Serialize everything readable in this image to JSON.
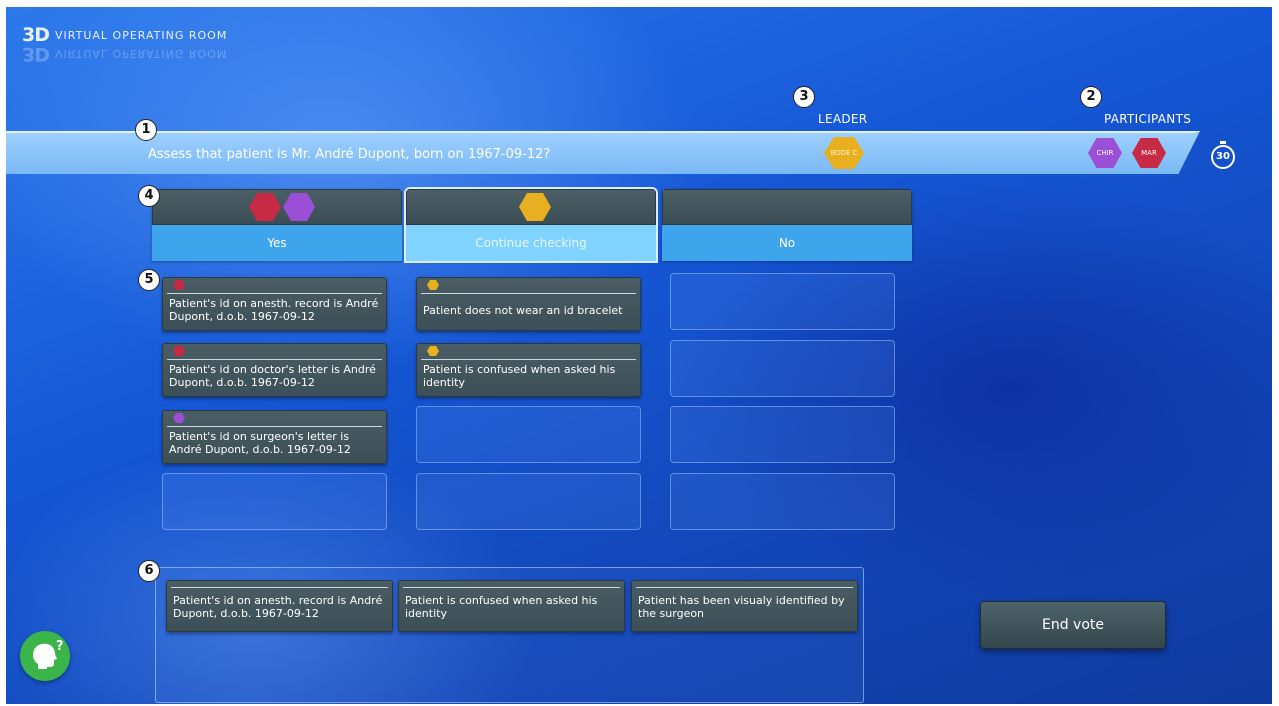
{
  "app": {
    "logo_3d": "3D",
    "logo_text": "VIRTUAL OPERATING ROOM"
  },
  "header": {
    "leader_label": "LEADER",
    "participants_label": "PARTICIPANTS",
    "question": "Assess that patient is Mr. André Dupont, born on 1967-09-12?",
    "leader_badge": "BODE C",
    "participants": [
      "CHIR",
      "MAR"
    ],
    "timer": "30"
  },
  "callouts": [
    "1",
    "2",
    "3",
    "4",
    "5",
    "6"
  ],
  "columns": [
    {
      "label": "Yes"
    },
    {
      "label": "Continue checking"
    },
    {
      "label": "No"
    }
  ],
  "cards": {
    "yes": [
      "Patient's id on anesth. record is André Dupont, d.o.b. 1967-09-12",
      "Patient's id on doctor's letter is André Dupont, d.o.b. 1967-09-12",
      "Patient's id on surgeon's letter is André Dupont, d.o.b. 1967-09-12"
    ],
    "continue": [
      "Patient does not wear an id bracelet",
      "Patient is confused when asked his identity"
    ]
  },
  "tray": [
    "Patient's id on anesth. record is André Dupont, d.o.b. 1967-09-12",
    "Patient is confused when asked his identity",
    "Patient has been visualy identified by the surgeon"
  ],
  "actions": {
    "end_vote": "End vote"
  },
  "colors": {
    "red": "#c62a45",
    "purple": "#9a4fd6",
    "yellow": "#e8b020",
    "column_blue": "#3ea5ec",
    "help_green": "#3bb44a"
  },
  "icons": {
    "help": "help-head-icon",
    "timer": "stopwatch-icon"
  }
}
